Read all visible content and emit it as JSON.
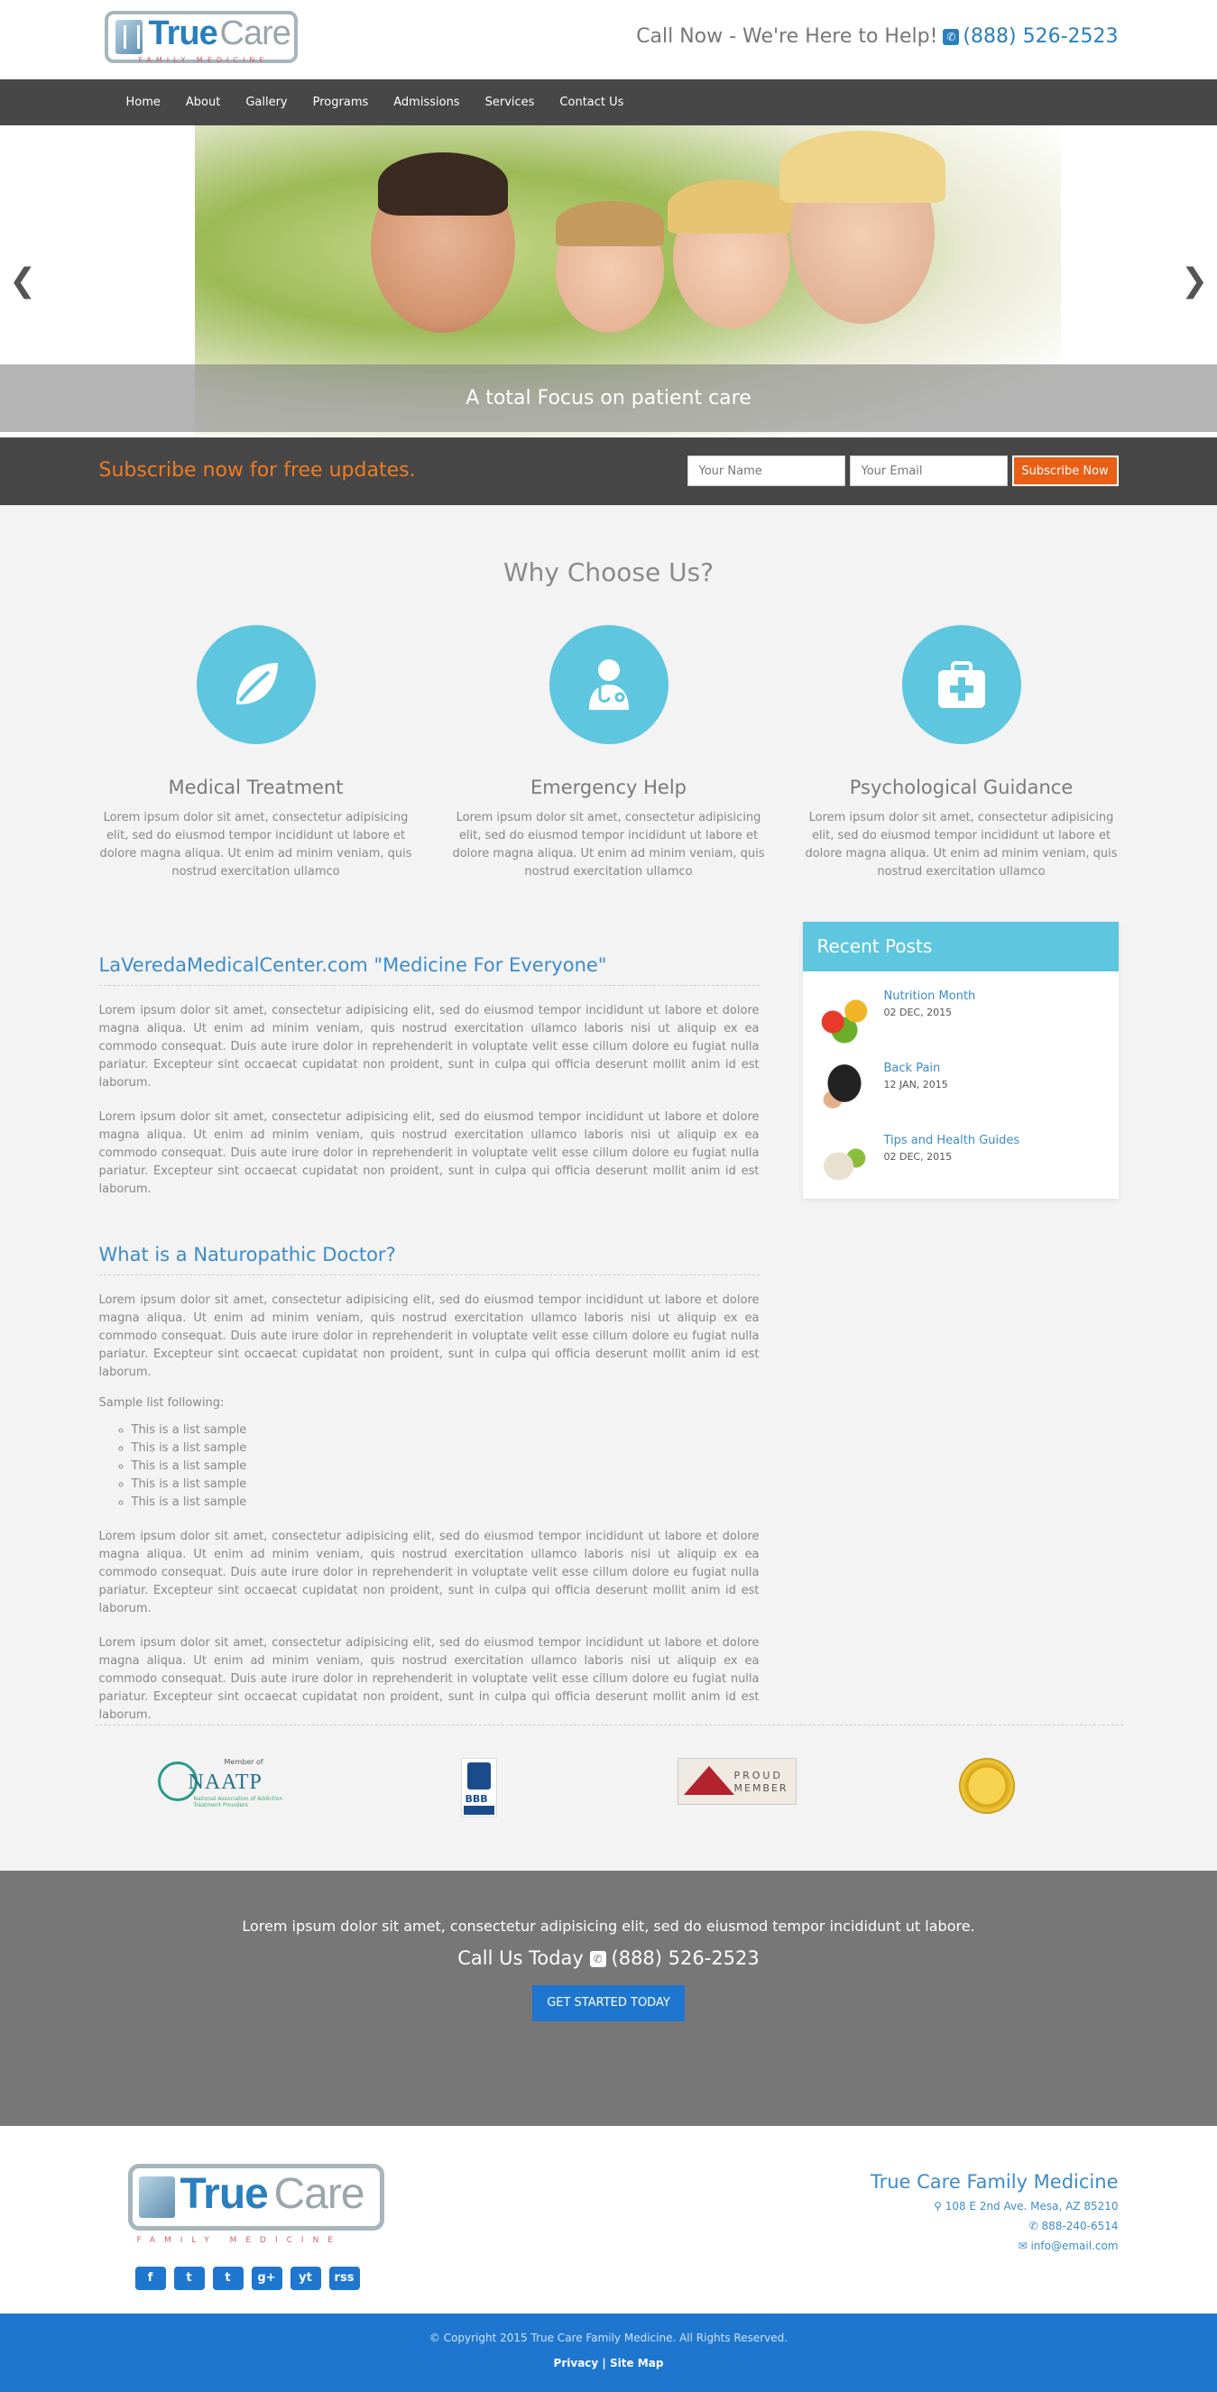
{
  "header": {
    "logo": {
      "word1": "True",
      "word2": "Care",
      "subtitle": "FAMILY MEDICINE"
    },
    "call_text": "Call Now - We're Here to Help!",
    "phone": "(888) 526-2523"
  },
  "nav": {
    "items": [
      "Home",
      "About",
      "Gallery",
      "Programs",
      "Admissions",
      "Services",
      "Contact Us"
    ]
  },
  "hero": {
    "caption": "A total Focus on patient care",
    "prev_icon": "chevron-left-icon",
    "next_icon": "chevron-right-icon"
  },
  "subscribe": {
    "text": "Subscribe now for free updates.",
    "name_placeholder": "Your Name",
    "email_placeholder": "Your Email",
    "button": "Subscribe Now"
  },
  "why": {
    "title": "Why Choose Us?",
    "features": [
      {
        "icon": "leaf-icon",
        "title": "Medical Treatment",
        "text": "Lorem ipsum dolor sit amet, consectetur adipisicing elit, sed do eiusmod tempor incididunt ut labore et dolore magna aliqua. Ut enim ad minim veniam, quis nostrud exercitation ullamco"
      },
      {
        "icon": "doctor-icon",
        "title": "Emergency Help",
        "text": "Lorem ipsum dolor sit amet, consectetur adipisicing elit, sed do eiusmod tempor incididunt ut labore et dolore magna aliqua. Ut enim ad minim veniam, quis nostrud exercitation ullamco"
      },
      {
        "icon": "medkit-icon",
        "title": "Psychological Guidance",
        "text": "Lorem ipsum dolor sit amet, consectetur adipisicing elit, sed do eiusmod tempor incididunt ut labore et dolore magna aliqua. Ut enim ad minim veniam, quis nostrud exercitation ullamco"
      }
    ]
  },
  "main": {
    "heading1": "LaVeredaMedicalCenter.com \"Medicine For Everyone\"",
    "para1": "Lorem ipsum dolor sit amet, consectetur adipisicing elit, sed do eiusmod tempor incididunt ut labore et dolore magna aliqua. Ut enim ad minim veniam, quis nostrud exercitation ullamco laboris nisi ut aliquip ex ea commodo consequat. Duis aute irure dolor in reprehenderit in voluptate velit esse cillum dolore eu fugiat nulla pariatur. Excepteur sint occaecat cupidatat non proident, sunt in culpa qui officia deserunt mollit anim id est laborum.",
    "para2": "Lorem ipsum dolor sit amet, consectetur adipisicing elit, sed do eiusmod tempor incididunt ut labore et dolore magna aliqua. Ut enim ad minim veniam, quis nostrud exercitation ullamco laboris nisi ut aliquip ex ea commodo consequat. Duis aute irure dolor in reprehenderit in voluptate velit esse cillum dolore eu fugiat nulla pariatur. Excepteur sint occaecat cupidatat non proident, sunt in culpa qui officia deserunt mollit anim id est laborum.",
    "heading2": "What is a Naturopathic Doctor?",
    "para3": "Lorem ipsum dolor sit amet, consectetur adipisicing elit, sed do eiusmod tempor incididunt ut labore et dolore magna aliqua. Ut enim ad minim veniam, quis nostrud exercitation ullamco laboris nisi ut aliquip ex ea commodo consequat. Duis aute irure dolor in reprehenderit in voluptate velit esse cillum dolore eu fugiat nulla pariatur. Excepteur sint occaecat cupidatat non proident, sunt in culpa qui officia deserunt mollit anim id est laborum.",
    "list_intro": "Sample list following:",
    "list": [
      "This is a list sample",
      "This is a list sample",
      "This is a list sample",
      "This is a list sample",
      "This is a list sample"
    ],
    "para4": "Lorem ipsum dolor sit amet, consectetur adipisicing elit, sed do eiusmod tempor incididunt ut labore et dolore magna aliqua. Ut enim ad minim veniam, quis nostrud exercitation ullamco laboris nisi ut aliquip ex ea commodo consequat. Duis aute irure dolor in reprehenderit in voluptate velit esse cillum dolore eu fugiat nulla pariatur. Excepteur sint occaecat cupidatat non proident, sunt in culpa qui officia deserunt mollit anim id est laborum.",
    "para5": "Lorem ipsum dolor sit amet, consectetur adipisicing elit, sed do eiusmod tempor incididunt ut labore et dolore magna aliqua. Ut enim ad minim veniam, quis nostrud exercitation ullamco laboris nisi ut aliquip ex ea commodo consequat. Duis aute irure dolor in reprehenderit in voluptate velit esse cillum dolore eu fugiat nulla pariatur. Excepteur sint occaecat cupidatat non proident, sunt in culpa qui officia deserunt mollit anim id est laborum."
  },
  "recent": {
    "title": "Recent Posts",
    "posts": [
      {
        "title": "Nutrition Month",
        "date": "02 DEC, 2015"
      },
      {
        "title": "Back Pain",
        "date": "12 JAN, 2015"
      },
      {
        "title": "Tips and Health Guides",
        "date": "02 DEC, 2015"
      }
    ]
  },
  "members": {
    "naatp": {
      "member_of": "Member of",
      "name": "NAATP",
      "full": "National Association of Addiction Treatment Providers"
    },
    "bbb": "BBB",
    "mesa": {
      "line1": "PROUD",
      "line2": "MEMBER"
    }
  },
  "cta": {
    "text": "Lorem ipsum dolor sit amet, consectetur adipisicing elit, sed do eiusmod tempor incididunt ut labore.",
    "call_label": "Call Us Today",
    "phone": "(888) 526-2523",
    "button": "GET STARTED TODAY"
  },
  "footer": {
    "name": "True Care Family Medicine",
    "address": "108 E 2nd Ave. Mesa, AZ 85210",
    "phone": "888-240-6514",
    "email": "info@email.com",
    "social": [
      "f",
      "t",
      "t",
      "g+",
      "yt",
      "rss"
    ]
  },
  "copyright": {
    "text": "© Copyright 2015 True Care Family Medicine. All Rights Reserved.",
    "privacy": "Privacy",
    "sep": "|",
    "sitemap": "Site Map"
  },
  "colors": {
    "accent": "#5ec6de",
    "brand_blue": "#1e76cf",
    "orange": "#e95f16",
    "dark": "#474747"
  }
}
